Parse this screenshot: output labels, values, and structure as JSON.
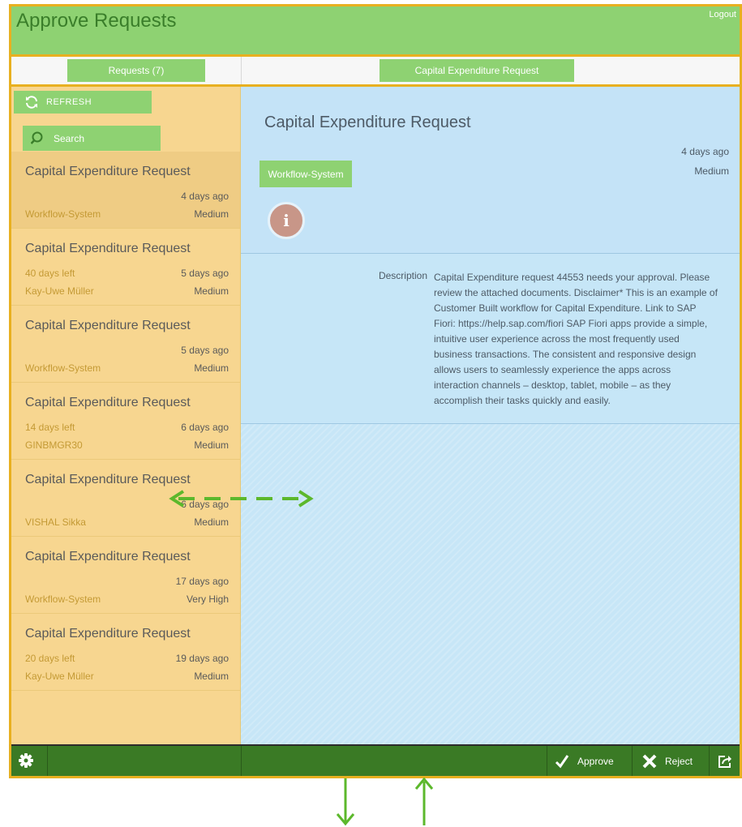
{
  "header": {
    "title": "Approve Requests",
    "logout_label": "Logout"
  },
  "subheader": {
    "master_title": "Requests (7)",
    "detail_tab": "Capital Expenditure Request"
  },
  "master": {
    "refresh_label": "REFRESH",
    "search_placeholder": "Search",
    "items": [
      {
        "title": "Capital Expenditure Request",
        "time_left": "",
        "ago": "4 days ago",
        "creator": "Workflow-System",
        "priority": "Medium"
      },
      {
        "title": "Capital Expenditure Request",
        "time_left": "40 days left",
        "ago": "5 days ago",
        "creator": "Kay-Uwe Müller",
        "priority": "Medium"
      },
      {
        "title": "Capital Expenditure Request",
        "time_left": "",
        "ago": "5 days ago",
        "creator": "Workflow-System",
        "priority": "Medium"
      },
      {
        "title": "Capital Expenditure Request",
        "time_left": "14 days left",
        "ago": "6 days ago",
        "creator": "GINBMGR30",
        "priority": "Medium"
      },
      {
        "title": "Capital Expenditure Request",
        "time_left": "",
        "ago": "6 days ago",
        "creator": "VISHAL Sikka",
        "priority": "Medium"
      },
      {
        "title": "Capital Expenditure Request",
        "time_left": "",
        "ago": "17 days ago",
        "creator": "Workflow-System",
        "priority": "Very High"
      },
      {
        "title": "Capital Expenditure Request",
        "time_left": "20 days left",
        "ago": "19 days ago",
        "creator": "Kay-Uwe Müller",
        "priority": "Medium"
      }
    ]
  },
  "detail": {
    "title": "Capital Expenditure Request",
    "ago": "4 days ago",
    "priority": "Medium",
    "creator": "Workflow-System",
    "info_glyph": "i",
    "description_label": "Description",
    "description": "Capital Expenditure request 44553 needs your approval. Please review the attached documents. Disclaimer* This is an example of Customer Built workflow for Capital Expenditure. Link to SAP Fiori: https://help.sap.com/fiori SAP Fiori apps provide a simple, intuitive user experience across the most frequently used business transactions. The consistent and responsive design allows users to seamlessly experience the apps across interaction channels – desktop, tablet, mobile – as they accomplish their tasks quickly and easily."
  },
  "footer": {
    "approve_label": "Approve",
    "reject_label": "Reject"
  },
  "icons": {
    "refresh": "refresh-icon",
    "search": "search-icon",
    "info": "info-icon",
    "settings": "gear-icon",
    "approve": "checkmark-icon",
    "reject": "x-icon",
    "share": "share-icon"
  },
  "colors": {
    "highlight_green": "#8ed272",
    "frame_orange": "#e8b020",
    "master_bg": "#f7d690",
    "detail_bg": "#c7e6f7",
    "footer_bg": "#3a7a25",
    "arrow_green": "#5cb82c"
  }
}
